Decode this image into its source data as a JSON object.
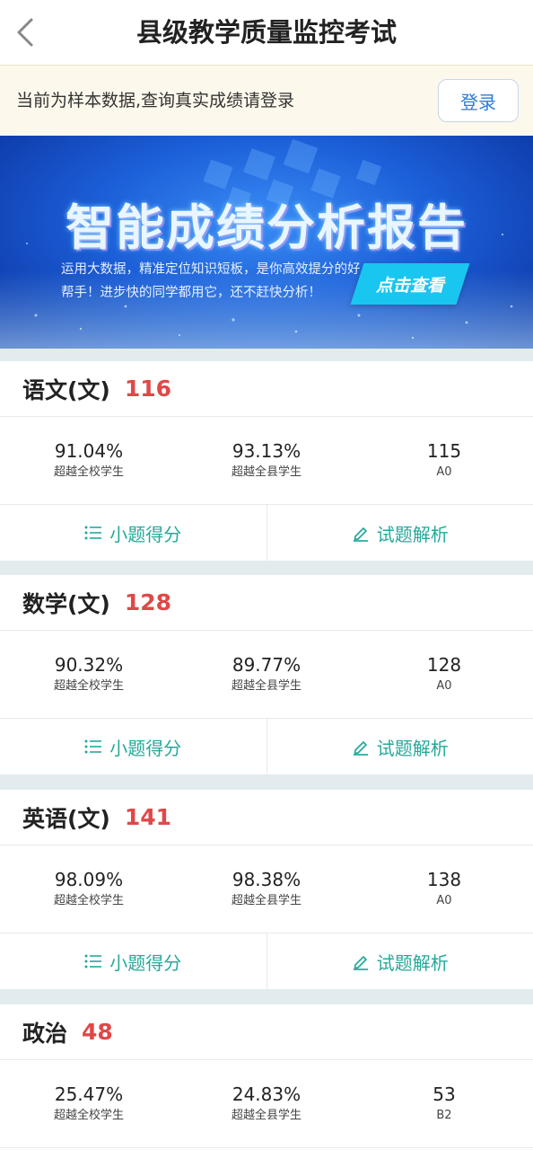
{
  "header": {
    "title": "县级教学质量监控考试"
  },
  "notice": {
    "text": "当前为样本数据,查询真实成绩请登录",
    "login_label": "登录"
  },
  "banner": {
    "title": "智能成绩分析报告",
    "description": "运用大数据，精准定位知识短板，是你高效提分的好帮手！进步快的同学都用它，还不赶快分析！",
    "cta_label": "点击查看"
  },
  "subjects": [
    {
      "name": "语文(文)",
      "score": "116",
      "stats": [
        {
          "value": "91.04%",
          "label": "超越全校学生"
        },
        {
          "value": "93.13%",
          "label": "超越全县学生"
        },
        {
          "value": "115",
          "label": "A0"
        }
      ],
      "actions": {
        "breakdown": "小题得分",
        "analysis": "试题解析"
      }
    },
    {
      "name": "数学(文)",
      "score": "128",
      "stats": [
        {
          "value": "90.32%",
          "label": "超越全校学生"
        },
        {
          "value": "89.77%",
          "label": "超越全县学生"
        },
        {
          "value": "128",
          "label": "A0"
        }
      ],
      "actions": {
        "breakdown": "小题得分",
        "analysis": "试题解析"
      }
    },
    {
      "name": "英语(文)",
      "score": "141",
      "stats": [
        {
          "value": "98.09%",
          "label": "超越全校学生"
        },
        {
          "value": "98.38%",
          "label": "超越全县学生"
        },
        {
          "value": "138",
          "label": "A0"
        }
      ],
      "actions": {
        "breakdown": "小题得分",
        "analysis": "试题解析"
      }
    },
    {
      "name": "政治",
      "score": "48",
      "stats": [
        {
          "value": "25.47%",
          "label": "超越全校学生"
        },
        {
          "value": "24.83%",
          "label": "超越全县学生"
        },
        {
          "value": "53",
          "label": "B2"
        }
      ]
    }
  ],
  "colors": {
    "score_red": "#e04848",
    "action_teal": "#26a89a",
    "login_blue": "#2c7cd6",
    "page_bg": "#e2ecee",
    "notice_bg": "#fdf8ec"
  }
}
